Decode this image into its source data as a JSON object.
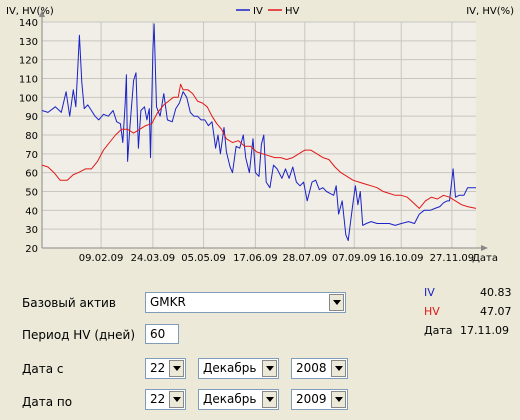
{
  "chart_data": {
    "type": "line",
    "ylabel_left": "IV, HV(%)",
    "ylabel_right": "IV, HV(%)",
    "ylim": [
      20,
      140
    ],
    "yticks": [
      20,
      30,
      40,
      50,
      60,
      70,
      80,
      90,
      100,
      110,
      120,
      130,
      140
    ],
    "xlim": [
      "2008-12-22",
      "2009-12-17"
    ],
    "xticks": [
      {
        "date": "2009-02-09",
        "label": "09.02.09"
      },
      {
        "date": "2009-03-24",
        "label": "24.03.09"
      },
      {
        "date": "2009-05-05",
        "label": "05.05.09"
      },
      {
        "date": "2009-06-17",
        "label": "17.06.09"
      },
      {
        "date": "2009-07-28",
        "label": "28.07.09"
      },
      {
        "date": "2009-09-07",
        "label": "07.09.09"
      },
      {
        "date": "2009-10-16",
        "label": "16.10.09"
      },
      {
        "date": "2009-11-27",
        "label": "27.11.09"
      }
    ],
    "x_end_label": "Дата",
    "grid": true,
    "legend_position": "top",
    "series": [
      {
        "name": "IV",
        "color": "#1a22c8",
        "points": [
          [
            "2008-12-22",
            93
          ],
          [
            "2008-12-27",
            92
          ],
          [
            "2009-01-02",
            95
          ],
          [
            "2009-01-07",
            92
          ],
          [
            "2009-01-11",
            103
          ],
          [
            "2009-01-14",
            90
          ],
          [
            "2009-01-17",
            104
          ],
          [
            "2009-01-19",
            95
          ],
          [
            "2009-01-21",
            120
          ],
          [
            "2009-01-22",
            133
          ],
          [
            "2009-01-24",
            108
          ],
          [
            "2009-01-26",
            94
          ],
          [
            "2009-01-29",
            96
          ],
          [
            "2009-02-01",
            93
          ],
          [
            "2009-02-04",
            90
          ],
          [
            "2009-02-07",
            88
          ],
          [
            "2009-02-11",
            91
          ],
          [
            "2009-02-15",
            90
          ],
          [
            "2009-02-19",
            93
          ],
          [
            "2009-02-22",
            87
          ],
          [
            "2009-02-25",
            86
          ],
          [
            "2009-02-27",
            76
          ],
          [
            "2009-03-01",
            97
          ],
          [
            "2009-03-02",
            112
          ],
          [
            "2009-03-03",
            66
          ],
          [
            "2009-03-05",
            85
          ],
          [
            "2009-03-08",
            109
          ],
          [
            "2009-03-10",
            113
          ],
          [
            "2009-03-12",
            73
          ],
          [
            "2009-03-14",
            93
          ],
          [
            "2009-03-17",
            95
          ],
          [
            "2009-03-19",
            88
          ],
          [
            "2009-03-21",
            94
          ],
          [
            "2009-03-22",
            68
          ],
          [
            "2009-03-24",
            125
          ],
          [
            "2009-03-25",
            139
          ],
          [
            "2009-03-27",
            95
          ],
          [
            "2009-03-30",
            90
          ],
          [
            "2009-04-02",
            102
          ],
          [
            "2009-04-05",
            88
          ],
          [
            "2009-04-09",
            87
          ],
          [
            "2009-04-12",
            94
          ],
          [
            "2009-04-15",
            97
          ],
          [
            "2009-04-18",
            103
          ],
          [
            "2009-04-21",
            100
          ],
          [
            "2009-04-24",
            92
          ],
          [
            "2009-04-27",
            90
          ],
          [
            "2009-04-30",
            90
          ],
          [
            "2009-05-03",
            88
          ],
          [
            "2009-05-06",
            88
          ],
          [
            "2009-05-09",
            85
          ],
          [
            "2009-05-12",
            87
          ],
          [
            "2009-05-14",
            78
          ],
          [
            "2009-05-15",
            73
          ],
          [
            "2009-05-17",
            80
          ],
          [
            "2009-05-19",
            70
          ],
          [
            "2009-05-22",
            84
          ],
          [
            "2009-05-24",
            71
          ],
          [
            "2009-05-27",
            63
          ],
          [
            "2009-05-29",
            60
          ],
          [
            "2009-06-01",
            74
          ],
          [
            "2009-06-04",
            73
          ],
          [
            "2009-06-07",
            80
          ],
          [
            "2009-06-09",
            68
          ],
          [
            "2009-06-12",
            60
          ],
          [
            "2009-06-15",
            78
          ],
          [
            "2009-06-17",
            60
          ],
          [
            "2009-06-20",
            58
          ],
          [
            "2009-06-22",
            75
          ],
          [
            "2009-06-24",
            80
          ],
          [
            "2009-06-26",
            55
          ],
          [
            "2009-06-29",
            52
          ],
          [
            "2009-07-02",
            64
          ],
          [
            "2009-07-05",
            62
          ],
          [
            "2009-07-09",
            57
          ],
          [
            "2009-07-12",
            62
          ],
          [
            "2009-07-15",
            57
          ],
          [
            "2009-07-18",
            63
          ],
          [
            "2009-07-21",
            55
          ],
          [
            "2009-07-24",
            53
          ],
          [
            "2009-07-27",
            55
          ],
          [
            "2009-07-30",
            45
          ],
          [
            "2009-08-03",
            55
          ],
          [
            "2009-08-06",
            56
          ],
          [
            "2009-08-09",
            51
          ],
          [
            "2009-08-12",
            52
          ],
          [
            "2009-08-15",
            50
          ],
          [
            "2009-08-18",
            49
          ],
          [
            "2009-08-21",
            48
          ],
          [
            "2009-08-23",
            53
          ],
          [
            "2009-08-25",
            38
          ],
          [
            "2009-08-28",
            45
          ],
          [
            "2009-08-31",
            27
          ],
          [
            "2009-09-02",
            24
          ],
          [
            "2009-09-04",
            34
          ],
          [
            "2009-09-06",
            44
          ],
          [
            "2009-09-08",
            53
          ],
          [
            "2009-09-10",
            43
          ],
          [
            "2009-09-12",
            50
          ],
          [
            "2009-09-14",
            32
          ],
          [
            "2009-09-17",
            33
          ],
          [
            "2009-09-21",
            34
          ],
          [
            "2009-09-26",
            33
          ],
          [
            "2009-10-01",
            33
          ],
          [
            "2009-10-06",
            33
          ],
          [
            "2009-10-11",
            32
          ],
          [
            "2009-10-16",
            33
          ],
          [
            "2009-10-22",
            34
          ],
          [
            "2009-10-27",
            33
          ],
          [
            "2009-10-31",
            38
          ],
          [
            "2009-11-04",
            40
          ],
          [
            "2009-11-09",
            40
          ],
          [
            "2009-11-13",
            41
          ],
          [
            "2009-11-17",
            42
          ],
          [
            "2009-11-20",
            44
          ],
          [
            "2009-11-23",
            45
          ],
          [
            "2009-11-25",
            45
          ],
          [
            "2009-11-28",
            62
          ],
          [
            "2009-11-30",
            47
          ],
          [
            "2009-12-03",
            48
          ],
          [
            "2009-12-07",
            48
          ],
          [
            "2009-12-10",
            52
          ],
          [
            "2009-12-14",
            52
          ],
          [
            "2009-12-17",
            52
          ]
        ]
      },
      {
        "name": "HV",
        "color": "#e01818",
        "points": [
          [
            "2008-12-22",
            64
          ],
          [
            "2008-12-27",
            63
          ],
          [
            "2009-01-01",
            60
          ],
          [
            "2009-01-06",
            56
          ],
          [
            "2009-01-12",
            56
          ],
          [
            "2009-01-17",
            59
          ],
          [
            "2009-01-21",
            60
          ],
          [
            "2009-01-27",
            62
          ],
          [
            "2009-02-01",
            62
          ],
          [
            "2009-02-06",
            66
          ],
          [
            "2009-02-11",
            72
          ],
          [
            "2009-02-16",
            76
          ],
          [
            "2009-02-21",
            80
          ],
          [
            "2009-02-26",
            83
          ],
          [
            "2009-03-03",
            83
          ],
          [
            "2009-03-08",
            81
          ],
          [
            "2009-03-13",
            83
          ],
          [
            "2009-03-18",
            85
          ],
          [
            "2009-03-23",
            86
          ],
          [
            "2009-03-28",
            92
          ],
          [
            "2009-04-02",
            96
          ],
          [
            "2009-04-06",
            98
          ],
          [
            "2009-04-10",
            100
          ],
          [
            "2009-04-14",
            100
          ],
          [
            "2009-04-16",
            107
          ],
          [
            "2009-04-18",
            104
          ],
          [
            "2009-04-22",
            104
          ],
          [
            "2009-04-26",
            102
          ],
          [
            "2009-04-30",
            98
          ],
          [
            "2009-05-04",
            97
          ],
          [
            "2009-05-08",
            95
          ],
          [
            "2009-05-12",
            90
          ],
          [
            "2009-05-16",
            86
          ],
          [
            "2009-05-20",
            83
          ],
          [
            "2009-05-24",
            78
          ],
          [
            "2009-05-29",
            76
          ],
          [
            "2009-06-03",
            77
          ],
          [
            "2009-06-08",
            74
          ],
          [
            "2009-06-13",
            74
          ],
          [
            "2009-06-18",
            71
          ],
          [
            "2009-06-23",
            70
          ],
          [
            "2009-06-28",
            69
          ],
          [
            "2009-07-03",
            68
          ],
          [
            "2009-07-08",
            68
          ],
          [
            "2009-07-13",
            67
          ],
          [
            "2009-07-18",
            68
          ],
          [
            "2009-07-23",
            70
          ],
          [
            "2009-07-28",
            72
          ],
          [
            "2009-08-02",
            72
          ],
          [
            "2009-08-07",
            70
          ],
          [
            "2009-08-12",
            68
          ],
          [
            "2009-08-17",
            67
          ],
          [
            "2009-08-22",
            63
          ],
          [
            "2009-08-27",
            60
          ],
          [
            "2009-09-01",
            58
          ],
          [
            "2009-09-06",
            56
          ],
          [
            "2009-09-11",
            55
          ],
          [
            "2009-09-16",
            54
          ],
          [
            "2009-09-21",
            53
          ],
          [
            "2009-09-26",
            52
          ],
          [
            "2009-10-01",
            50
          ],
          [
            "2009-10-06",
            49
          ],
          [
            "2009-10-11",
            48
          ],
          [
            "2009-10-16",
            48
          ],
          [
            "2009-10-21",
            47
          ],
          [
            "2009-10-26",
            44
          ],
          [
            "2009-10-31",
            41
          ],
          [
            "2009-11-05",
            45
          ],
          [
            "2009-11-10",
            47
          ],
          [
            "2009-11-15",
            46
          ],
          [
            "2009-11-20",
            48
          ],
          [
            "2009-11-25",
            47
          ],
          [
            "2009-11-30",
            45
          ],
          [
            "2009-12-05",
            43
          ],
          [
            "2009-12-10",
            42
          ],
          [
            "2009-12-17",
            41
          ]
        ]
      }
    ]
  },
  "form": {
    "base_asset_label": "Базовый актив",
    "base_asset_value": "GMKR",
    "hv_period_label": "Период HV (дней)",
    "hv_period_value": "60",
    "date_from_label": "Дата с",
    "date_from": {
      "day": "22",
      "month": "Декабрь",
      "year": "2008"
    },
    "date_to_label": "Дата по",
    "date_to": {
      "day": "22",
      "month": "Декабрь",
      "year": "2009"
    }
  },
  "readout": {
    "iv_label": "IV",
    "iv_value": "40.83",
    "iv_color": "#1a22c8",
    "hv_label": "HV",
    "hv_value": "47.07",
    "hv_color": "#e01818",
    "date_label": "Дата",
    "date_value": "17.11.09"
  }
}
